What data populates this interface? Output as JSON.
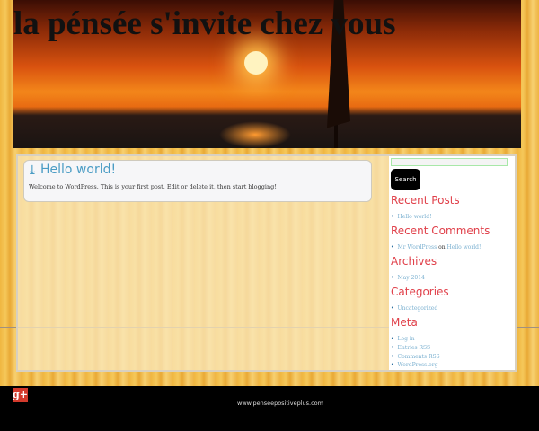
{
  "site_title": "la pénsée s'invite chez vous",
  "post": {
    "title": "Hello world!",
    "body": "Welcome to WordPress. This is your first post. Edit or delete it, then start blogging!"
  },
  "sidebar": {
    "search_label": "Search",
    "recent_posts": {
      "title": "Recent Posts",
      "items": [
        "Hello world!"
      ]
    },
    "recent_comments": {
      "title": "Recent Comments",
      "author": "Mr WordPress",
      "on": "on",
      "post": "Hello world!"
    },
    "archives": {
      "title": "Archives",
      "items": [
        "May 2014"
      ]
    },
    "categories": {
      "title": "Categories",
      "items": [
        "Uncategorized"
      ]
    },
    "meta": {
      "title": "Meta",
      "items": [
        "Log in",
        "Entries RSS",
        "Comments RSS",
        "WordPress.org"
      ]
    }
  },
  "footer": {
    "url": "www.penseepositiveplus.com",
    "gplus": "g+"
  }
}
